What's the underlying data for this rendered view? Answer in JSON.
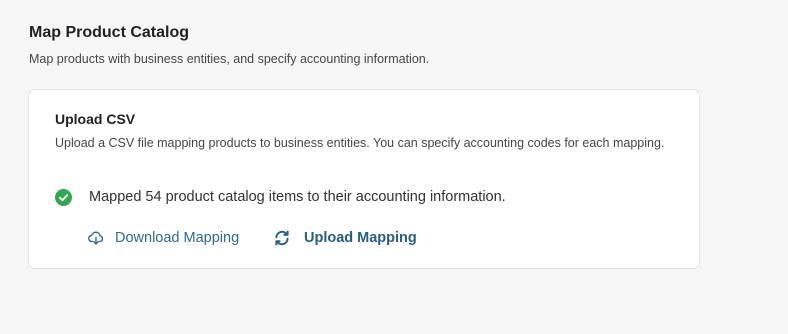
{
  "page": {
    "title": "Map Product Catalog",
    "subtitle": "Map products with business entities, and specify accounting information."
  },
  "card": {
    "title": "Upload CSV",
    "description": "Upload a CSV file mapping products to business entities. You can specify accounting codes for each mapping.",
    "status": {
      "icon": "check-circle-icon",
      "text": "Mapped 54 product catalog items to their accounting information."
    },
    "actions": {
      "download": {
        "icon": "cloud-download-icon",
        "label": "Download Mapping"
      },
      "upload": {
        "icon": "refresh-icon",
        "label": "Upload Mapping"
      }
    }
  },
  "colors": {
    "success": "#2fa84f",
    "link": "#2e6b8f",
    "background": "#f6f6f7",
    "card_border": "#e1e3e5"
  }
}
